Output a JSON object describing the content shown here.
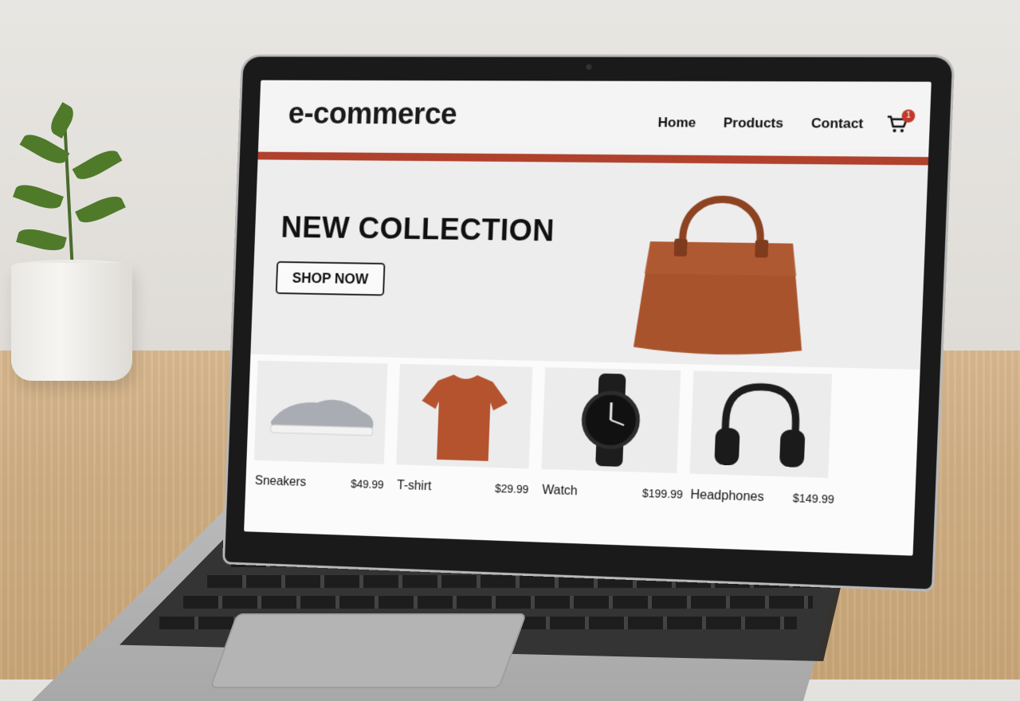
{
  "site": {
    "logo": "e-commerce",
    "nav": [
      "Home",
      "Products",
      "Contact"
    ],
    "cart_count": "1"
  },
  "hero": {
    "title": "NEW COLLECTION",
    "button": "SHOP NOW"
  },
  "products": [
    {
      "name": "Sneakers",
      "price": "$49.99"
    },
    {
      "name": "T-shirt",
      "price": "$29.99"
    },
    {
      "name": "Watch",
      "price": "$199.99"
    },
    {
      "name": "Headphones",
      "price": "$149.99"
    }
  ],
  "colors": {
    "accent": "#b0412d",
    "bag": "#a9532d",
    "tshirt": "#b5532f"
  },
  "icons": [
    "cart-icon",
    "sneaker-icon",
    "tshirt-icon",
    "watch-icon",
    "headphones-icon",
    "handbag-icon"
  ]
}
